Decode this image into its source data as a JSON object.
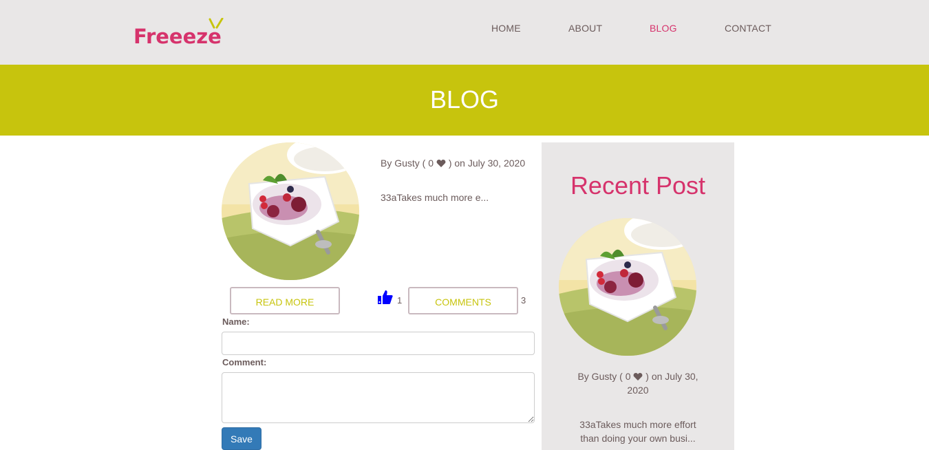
{
  "header": {
    "logo_text": "Freeeze",
    "nav": [
      {
        "label": "HOME"
      },
      {
        "label": "ABOUT"
      },
      {
        "label": "BLOG"
      },
      {
        "label": "CONTACT"
      }
    ],
    "active_nav": "BLOG"
  },
  "banner": {
    "title": "BLOG"
  },
  "post": {
    "image_icon": "dessert-bowl-image",
    "meta_prefix": "By Gusty ( 0",
    "meta_suffix": ") on July 30, 2020",
    "excerpt": "33aTakes much more e...",
    "read_more_label": "READ MORE",
    "like_count": "1",
    "comments_label": "COMMENTS",
    "comment_count": "3"
  },
  "form": {
    "name_label": "Name:",
    "name_value": "",
    "comment_label": "Comment:",
    "comment_value": "",
    "save_label": "Save"
  },
  "sidebar": {
    "title": "Recent Post",
    "image_icon": "dessert-bowl-image",
    "meta_prefix": "By Gusty ( 0",
    "meta_suffix": ") on July 30, 2020",
    "excerpt": "33aTakes much more effort than doing your own busi..."
  },
  "colors": {
    "brand_pink": "#d6336c",
    "banner_olive": "#c7c40d",
    "header_bg": "#e9e7e7",
    "text_gray": "#6b5b5b",
    "like_blue": "#0000ff",
    "save_blue": "#337ab7"
  }
}
